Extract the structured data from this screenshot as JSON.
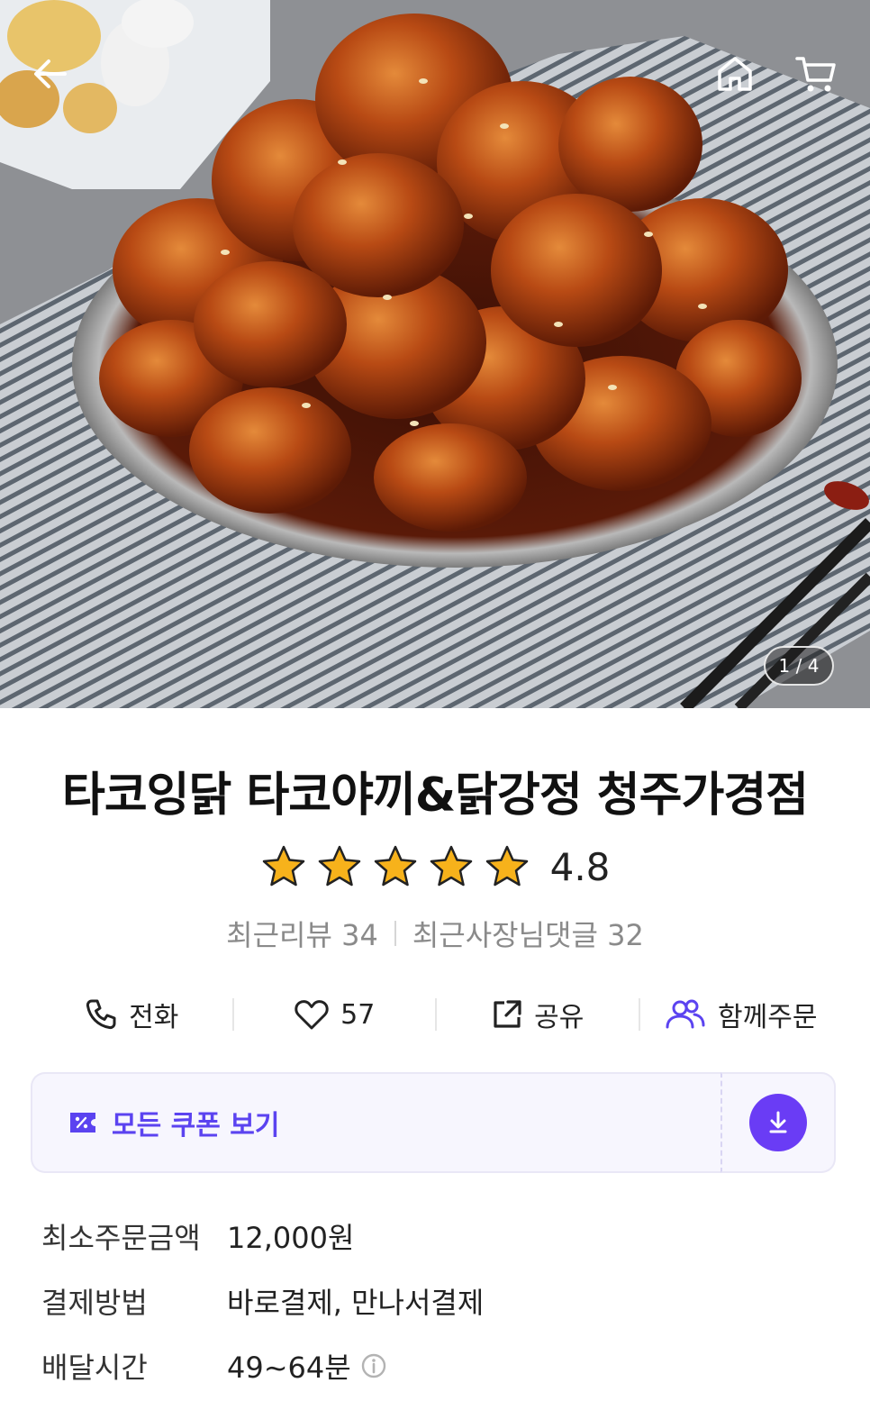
{
  "gallery": {
    "pager": "1 / 4",
    "back_icon": "arrow-left-icon",
    "home_icon": "home-icon",
    "cart_icon": "cart-icon"
  },
  "store": {
    "name": "타코잉닭 타코야끼&닭강정 청주가경점",
    "rating": "4.8",
    "stars": 5,
    "recent_reviews": "최근리뷰 34",
    "owner_replies": "최근사장님댓글 32"
  },
  "actions": {
    "call": "전화",
    "likes": "57",
    "share": "공유",
    "group_order": "함께주문"
  },
  "coupon": {
    "label": "모든 쿠폰 보기",
    "accent": "#5b43f0"
  },
  "info": {
    "min_order_label": "최소주문금액",
    "min_order_value": "12,000원",
    "payment_label": "결제방법",
    "payment_value": "바로결제, 만나서결제",
    "delivery_label": "배달시간",
    "delivery_value": "49~64분"
  }
}
